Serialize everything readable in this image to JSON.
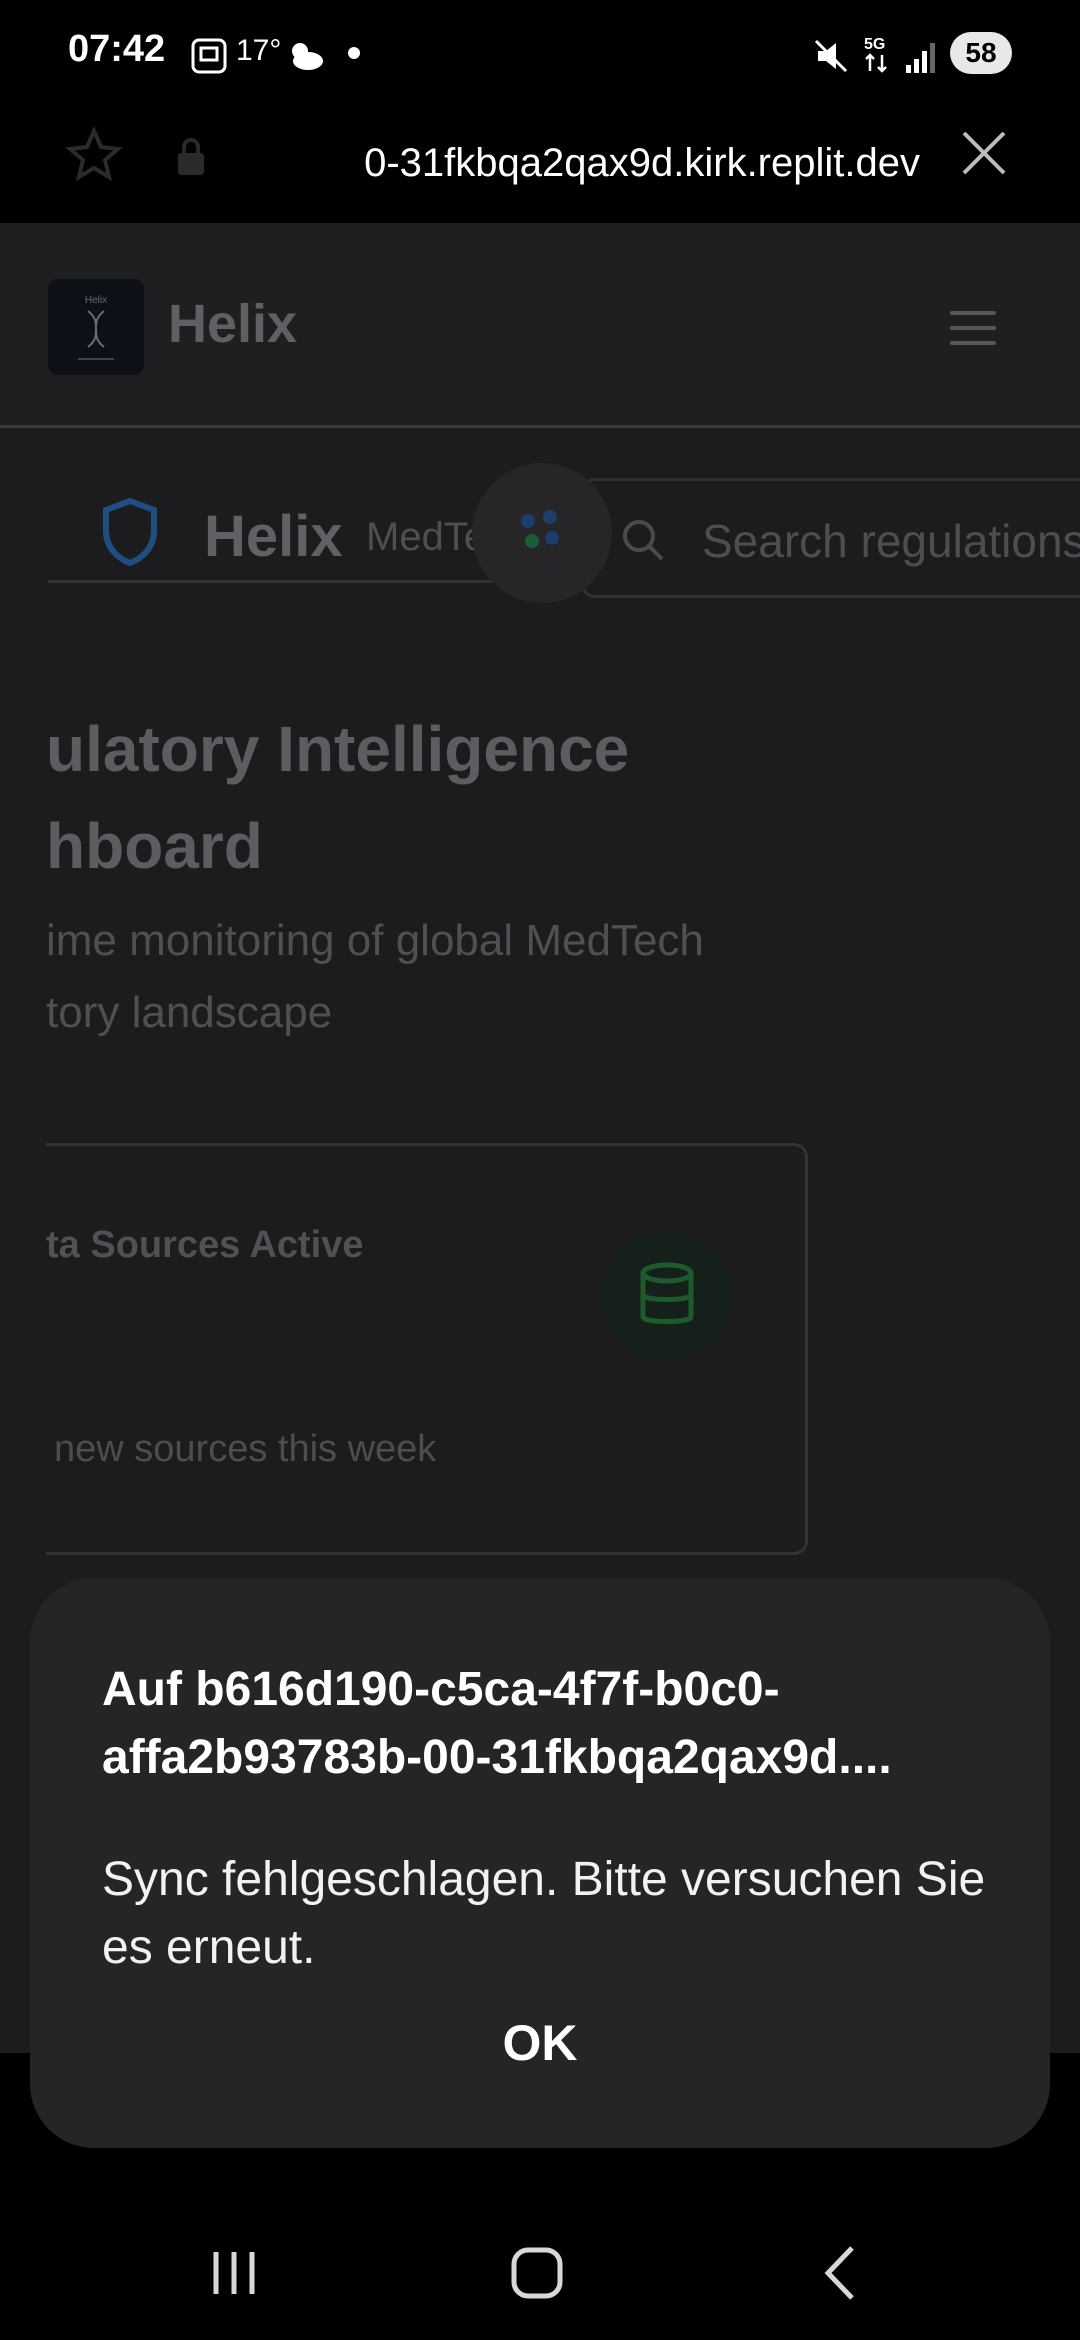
{
  "status_bar": {
    "time": "07:42",
    "temperature": "17°",
    "battery": "58",
    "icons": [
      "screenshot-icon",
      "weather-icon",
      "mute-icon",
      "5g-icon",
      "signal-icon"
    ]
  },
  "browser": {
    "url": "0-31fkbqa2qax9d.kirk.replit.dev",
    "icons": [
      "star-icon",
      "lock-icon",
      "close-icon"
    ]
  },
  "site": {
    "name": "Helix",
    "logo_text": "Helix"
  },
  "inner_nav": {
    "brand": "Helix",
    "sub": "MedTech",
    "search_placeholder": "Search regulations"
  },
  "dashboard": {
    "title": "ulatory Intelligence\nhboard",
    "subtitle": "ime monitoring of global MedTech\ntory landscape",
    "card": {
      "label": "ta Sources Active",
      "footnote": "new sources this week",
      "accent": "#2a7a3a"
    }
  },
  "dialog": {
    "title": "Auf b616d190-c5ca-4f7f-b0c0-affa2b93783b-00-31fkbqa2qax9d....",
    "message": "Sync fehlgeschlagen. Bitte versuchen Sie es erneut.",
    "ok_label": "OK"
  },
  "nav": {
    "icons": [
      "recent-apps-icon",
      "home-icon",
      "back-icon"
    ]
  }
}
